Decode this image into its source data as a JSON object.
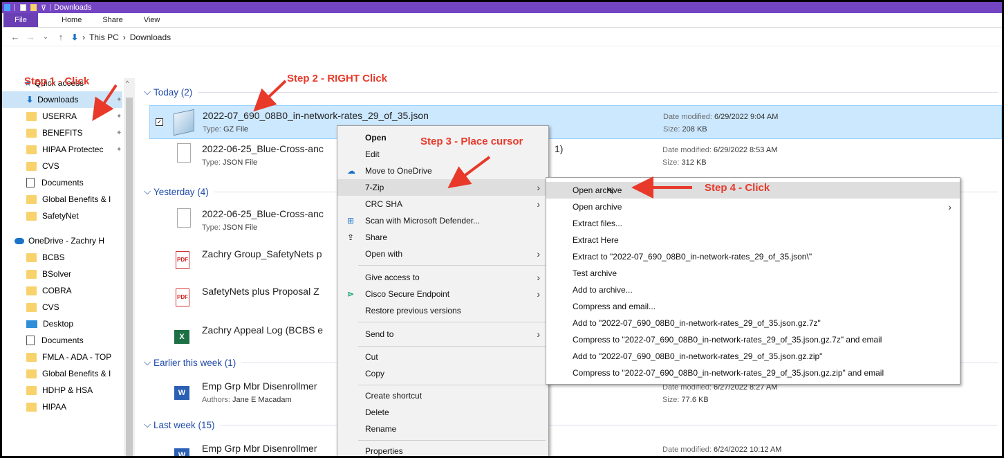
{
  "window": {
    "title": "Downloads"
  },
  "ribbon": {
    "file": "File",
    "home": "Home",
    "share": "Share",
    "view": "View"
  },
  "address": {
    "crumb1": "This PC",
    "crumb2": "Downloads"
  },
  "sidebar": {
    "quick_access": "Quick access",
    "items": [
      "Downloads",
      "USERRA",
      "BENEFITS",
      "HIPAA Protectec",
      "CVS",
      "Documents",
      "Global Benefits & I",
      "SafetyNet"
    ],
    "onedrive": "OneDrive - Zachry H",
    "od_items": [
      "BCBS",
      "BSolver",
      "COBRA",
      "CVS",
      "Desktop",
      "Documents",
      "FMLA - ADA - TOP",
      "Global Benefits & I",
      "HDHP & HSA",
      "HIPAA"
    ]
  },
  "groups": {
    "today": "Today (2)",
    "yesterday": "Yesterday (4)",
    "earlier": "Earlier this week (1)",
    "last_week": "Last week (15)"
  },
  "labels": {
    "type": "Type:",
    "date_modified": "Date modified:",
    "size": "Size:",
    "authors": "Authors:"
  },
  "files": [
    {
      "name": "2022-07_690_08B0_in-network-rates_29_of_35.json",
      "type": "GZ File",
      "date": "6/29/2022 9:04 AM",
      "size": "208 KB"
    },
    {
      "name": "2022-06-25_Blue-Cross-anc",
      "name_tail": "1)",
      "type": "JSON File",
      "date": "6/29/2022 8:53 AM",
      "size": "312 KB"
    },
    {
      "name": "2022-06-25_Blue-Cross-anc",
      "type": "JSON File"
    },
    {
      "name": "Zachry Group_SafetyNets p"
    },
    {
      "name": "SafetyNets plus Proposal Z"
    },
    {
      "name": "Zachry Appeal Log (BCBS e"
    },
    {
      "name": "Emp Grp Mbr Disenrollmer",
      "authors": "Jane E Macadam",
      "date": "6/27/2022 8:27 AM",
      "size": "77.6 KB"
    },
    {
      "name": "Emp Grp Mbr Disenrollmer",
      "date": "6/24/2022 10:12 AM"
    }
  ],
  "context_menu": [
    "Open",
    "Edit",
    "Move to OneDrive",
    "7-Zip",
    "CRC SHA",
    "Scan with Microsoft Defender...",
    "Share",
    "Open with",
    "Give access to",
    "Cisco Secure Endpoint",
    "Restore previous versions",
    "Send to",
    "Cut",
    "Copy",
    "Create shortcut",
    "Delete",
    "Rename",
    "Properties"
  ],
  "zip_menu": [
    "Open archive",
    "Open archive",
    "Extract files...",
    "Extract Here",
    "Extract to \"2022-07_690_08B0_in-network-rates_29_of_35.json\\\"",
    "Test archive",
    "Add to archive...",
    "Compress and email...",
    "Add to \"2022-07_690_08B0_in-network-rates_29_of_35.json.gz.7z\"",
    "Compress to \"2022-07_690_08B0_in-network-rates_29_of_35.json.gz.7z\" and email",
    "Add to \"2022-07_690_08B0_in-network-rates_29_of_35.json.gz.zip\"",
    "Compress to \"2022-07_690_08B0_in-network-rates_29_of_35.json.gz.zip\" and email"
  ],
  "annotations": {
    "step1": "Step 1 - Click",
    "step2": "Step 2 - RIGHT Click",
    "step3": "Step 3 - Place cursor",
    "step4": "Step 4 - Click"
  },
  "colors": {
    "title_bar": "#7445c2",
    "selection": "#cce8ff",
    "annotation": "#e8392a",
    "group_header": "#1e4aa8"
  }
}
